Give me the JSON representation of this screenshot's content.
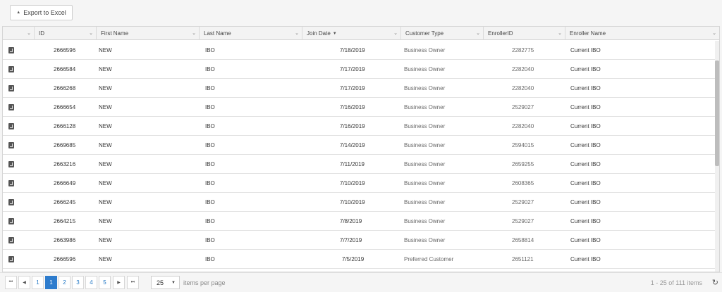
{
  "toolbar": {
    "export_label": "Export to Excel"
  },
  "columns": [
    {
      "key": "icon",
      "label": ""
    },
    {
      "key": "id",
      "label": "ID"
    },
    {
      "key": "first_name",
      "label": "First Name"
    },
    {
      "key": "last_name",
      "label": "Last Name"
    },
    {
      "key": "join_date",
      "label": "Join Date",
      "sorted": "desc"
    },
    {
      "key": "customer_type",
      "label": "Customer Type"
    },
    {
      "key": "enroller_id",
      "label": "EnrollerID"
    },
    {
      "key": "enroller_name",
      "label": "Enroller Name"
    }
  ],
  "rows": [
    {
      "id": "2666596",
      "first_name": "NEW",
      "last_name": "IBO",
      "join_date": "7/18/2019",
      "customer_type": "Business Owner",
      "enroller_id": "2282775",
      "enroller_name": "Current IBO"
    },
    {
      "id": "2666584",
      "first_name": "NEW",
      "last_name": "IBO",
      "join_date": "7/17/2019",
      "customer_type": "Business Owner",
      "enroller_id": "2282040",
      "enroller_name": "Current IBO"
    },
    {
      "id": "2666268",
      "first_name": "NEW",
      "last_name": "IBO",
      "join_date": "7/17/2019",
      "customer_type": "Business Owner",
      "enroller_id": "2282040",
      "enroller_name": "Current IBO"
    },
    {
      "id": "2666654",
      "first_name": "NEW",
      "last_name": "IBO",
      "join_date": "7/16/2019",
      "customer_type": "Business Owner",
      "enroller_id": "2529027",
      "enroller_name": "Current IBO"
    },
    {
      "id": "2666128",
      "first_name": "NEW",
      "last_name": "IBO",
      "join_date": "7/16/2019",
      "customer_type": "Business Owner",
      "enroller_id": "2282040",
      "enroller_name": "Current IBO"
    },
    {
      "id": "2669685",
      "first_name": "NEW",
      "last_name": "IBO",
      "join_date": "7/14/2019",
      "customer_type": "Business Owner",
      "enroller_id": "2594015",
      "enroller_name": "Current IBO"
    },
    {
      "id": "2663216",
      "first_name": "NEW",
      "last_name": "IBO",
      "join_date": "7/11/2019",
      "customer_type": "Business Owner",
      "enroller_id": "2659255",
      "enroller_name": "Current IBO"
    },
    {
      "id": "2666649",
      "first_name": "NEW",
      "last_name": "IBO",
      "join_date": "7/10/2019",
      "customer_type": "Business Owner",
      "enroller_id": "2608365",
      "enroller_name": "Current IBO"
    },
    {
      "id": "2666245",
      "first_name": "NEW",
      "last_name": "IBO",
      "join_date": "7/10/2019",
      "customer_type": "Business Owner",
      "enroller_id": "2529027",
      "enroller_name": "Current IBO"
    },
    {
      "id": "2664215",
      "first_name": "NEW",
      "last_name": "IBO",
      "join_date": "7/8/2019",
      "customer_type": "Business Owner",
      "enroller_id": "2529027",
      "enroller_name": "Current IBO"
    },
    {
      "id": "2663986",
      "first_name": "NEW",
      "last_name": "IBO",
      "join_date": "7/7/2019",
      "customer_type": "Business Owner",
      "enroller_id": "2658814",
      "enroller_name": "Current IBO"
    },
    {
      "id": "2666596",
      "first_name": "NEW",
      "last_name": "IBO",
      "join_date": "7/5/2019",
      "customer_type": "Preferred Customer",
      "enroller_id": "2651121",
      "enroller_name": "Current IBO"
    }
  ],
  "pager": {
    "first_icon": "first-page-icon",
    "prev_icon": "prev-page-icon",
    "next_icon": "next-page-icon",
    "last_icon": "last-page-icon",
    "pages": [
      "1",
      "1",
      "2",
      "3",
      "4",
      "5"
    ],
    "current_page": "1",
    "page_size": "25",
    "items_per_page_label": "items per page",
    "summary": "1 - 25 of 111 items",
    "refresh_icon": "refresh-icon"
  },
  "colors": {
    "accent": "#2e7ccd",
    "link": "#1f76c4",
    "header_bg": "#f3f3f3",
    "border": "#d6d6d6"
  }
}
